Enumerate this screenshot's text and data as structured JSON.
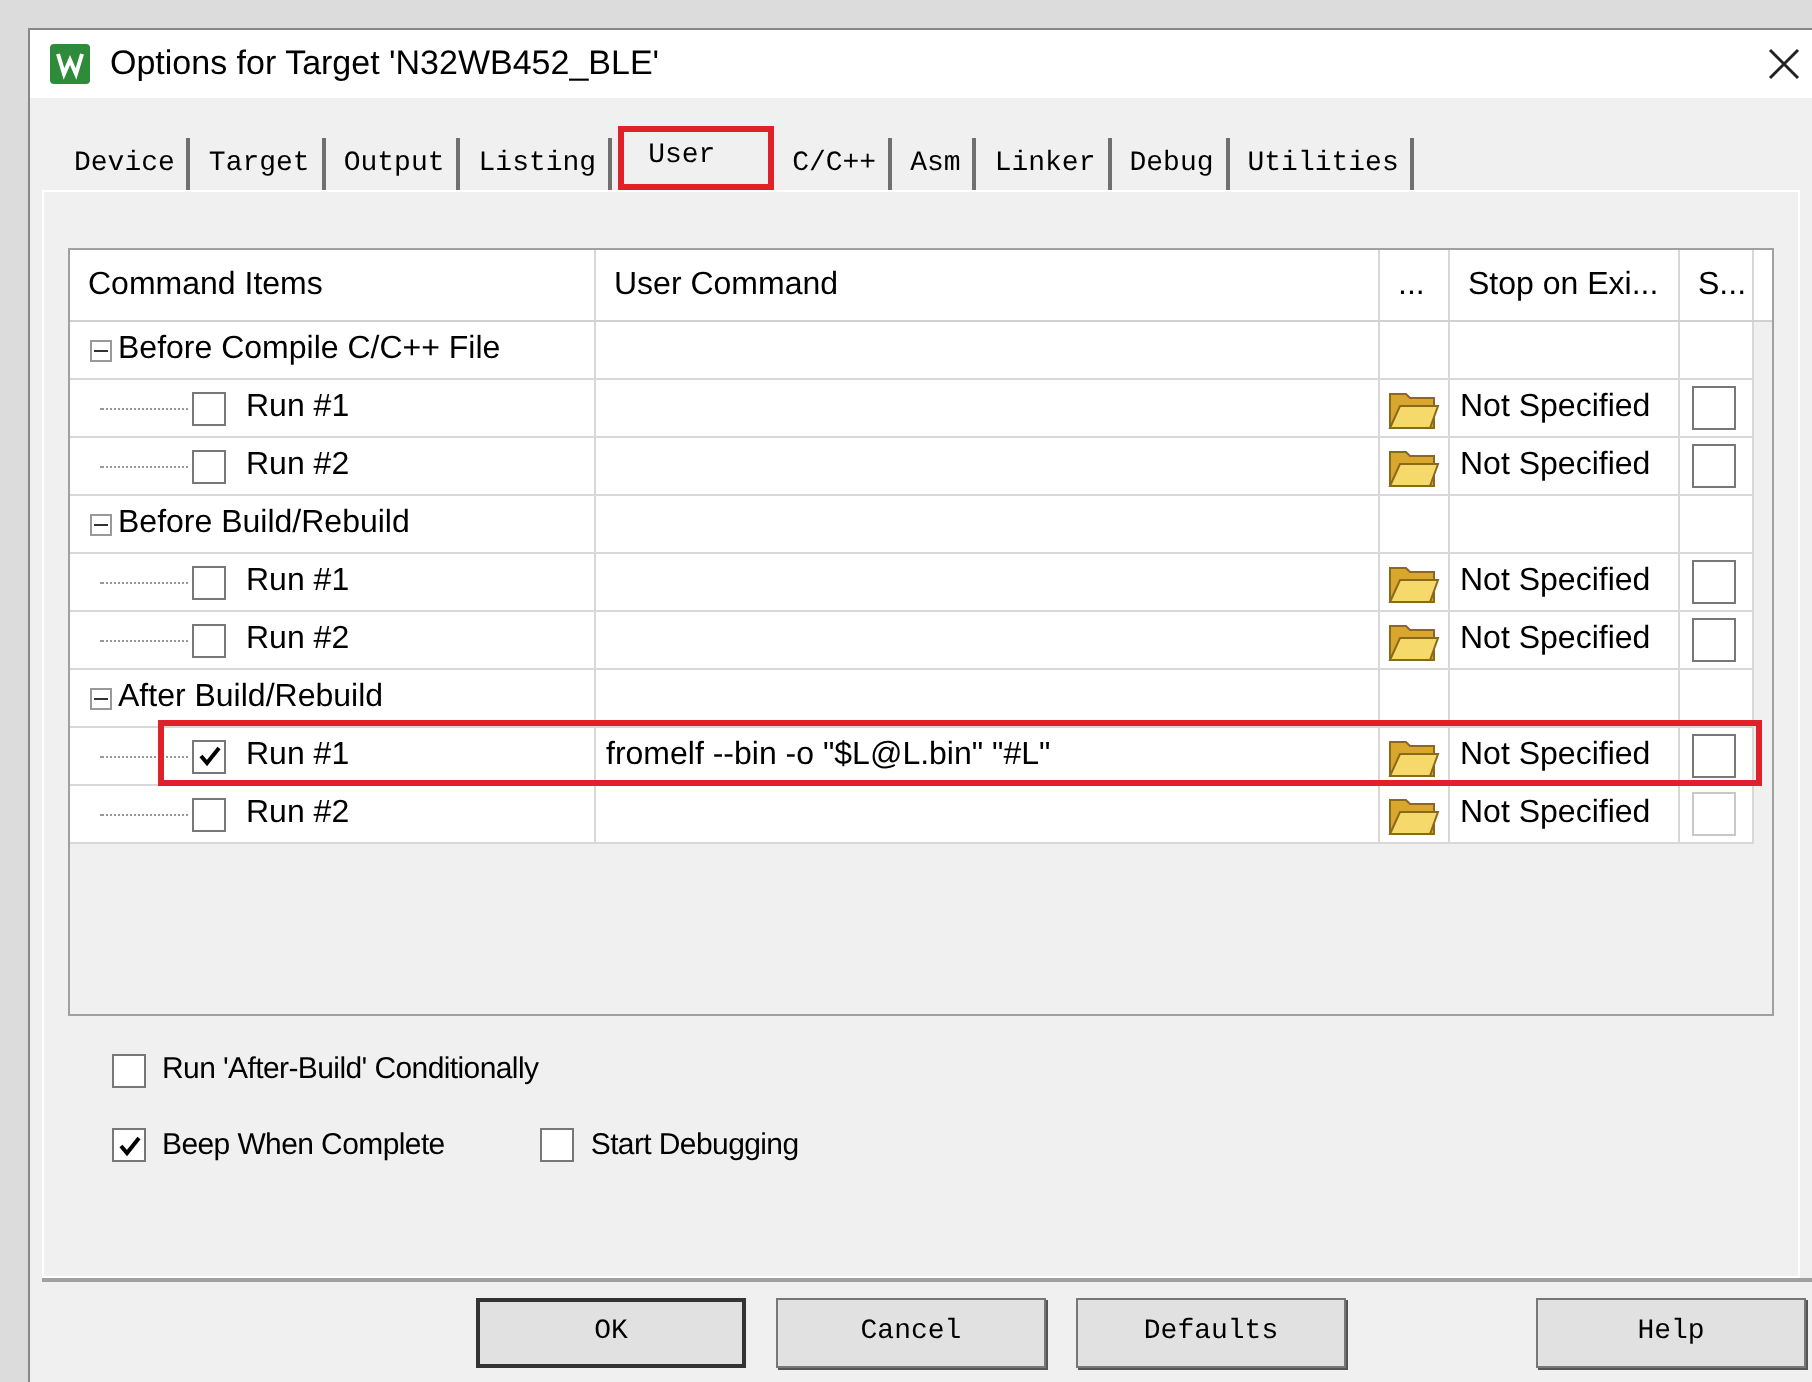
{
  "window": {
    "title": "Options for Target 'N32WB452_BLE'"
  },
  "tabs": [
    {
      "label": "Device",
      "selected": false,
      "highlighted": false
    },
    {
      "label": "Target",
      "selected": false,
      "highlighted": false
    },
    {
      "label": "Output",
      "selected": false,
      "highlighted": false
    },
    {
      "label": "Listing",
      "selected": false,
      "highlighted": false
    },
    {
      "label": "User",
      "selected": true,
      "highlighted": true
    },
    {
      "label": "C/C++",
      "selected": false,
      "highlighted": false
    },
    {
      "label": "Asm",
      "selected": false,
      "highlighted": false
    },
    {
      "label": "Linker",
      "selected": false,
      "highlighted": false
    },
    {
      "label": "Debug",
      "selected": false,
      "highlighted": false
    },
    {
      "label": "Utilities",
      "selected": false,
      "highlighted": false
    }
  ],
  "table": {
    "columns": [
      "Command Items",
      "User Command",
      "...",
      "Stop on Exi...",
      "S..."
    ],
    "groups": [
      {
        "label": "Before Compile C/C++ File",
        "expanded": true,
        "children": [
          {
            "label": "Run #1",
            "checked": false,
            "stop_on_exit": "Not Specified",
            "column_5_checked": false,
            "highlighted": false
          },
          {
            "label": "Run #2",
            "checked": false,
            "stop_on_exit": "Not Specified",
            "column_5_checked": false,
            "highlighted": false
          }
        ]
      },
      {
        "label": "Before Build/Rebuild",
        "expanded": true,
        "children": [
          {
            "label": "Run #1",
            "checked": false,
            "stop_on_exit": "Not Specified",
            "column_5_checked": false,
            "highlighted": false
          },
          {
            "label": "Run #2",
            "checked": false,
            "stop_on_exit": "Not Specified",
            "column_5_checked": false,
            "highlighted": false
          }
        ]
      },
      {
        "label": "After Build/Rebuild",
        "expanded": true,
        "children": [
          {
            "label": "Run #1",
            "checked": true,
            "command": "fromelf --bin -o \"$L@L.bin\" \"#L\"",
            "stop_on_exit": "Not Specified",
            "column_5_checked": false,
            "highlighted": true
          },
          {
            "label": "Run #2",
            "checked": false,
            "stop_on_exit": "Not Specified",
            "column_5_checked": false,
            "highlighted": false
          }
        ]
      }
    ]
  },
  "options": [
    [
      {
        "label": "Run 'After-Build' Conditionally",
        "checked": false
      }
    ],
    [
      {
        "label": "Beep When Complete",
        "checked": true
      },
      {
        "label": "Start Debugging",
        "checked": false
      }
    ]
  ],
  "buttons": [
    {
      "label": "OK",
      "default": true
    },
    {
      "label": "Cancel",
      "default": false
    },
    {
      "label": "Defaults",
      "default": false
    },
    {
      "label": "Help",
      "default": false
    }
  ]
}
